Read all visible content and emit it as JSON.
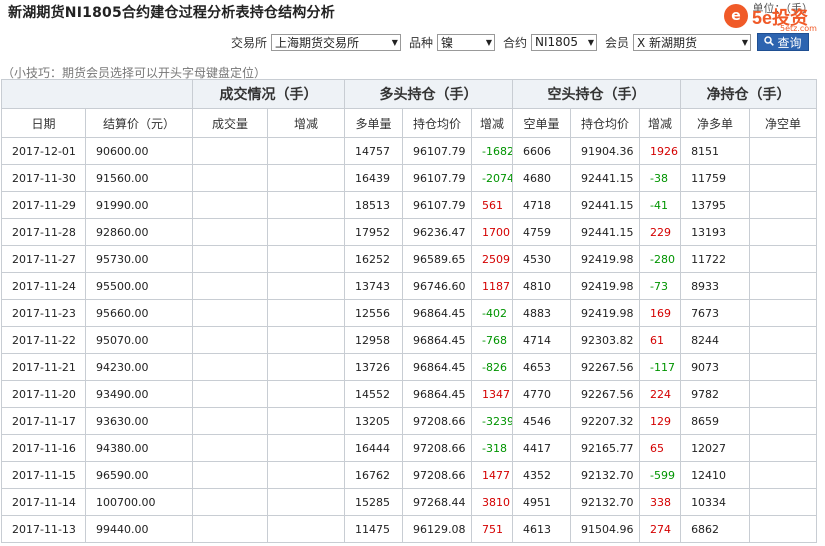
{
  "header": {
    "title": "新湖期货NI1805合约建仓过程分析表持仓结构分析",
    "unit": "单位：（手）"
  },
  "logo": {
    "mark": "e",
    "text": "5e投资",
    "sub": "5etz.com"
  },
  "filters": {
    "exchange_label": "交易所",
    "exchange_value": "上海期货交易所",
    "variety_label": "品种",
    "variety_value": "镍",
    "contract_label": "合约",
    "contract_value": "NI1805",
    "member_label": "会员",
    "member_value": "X 新湖期货",
    "query_label": "查询"
  },
  "tip": "（小技巧：期货会员选择可以开头字母键盘定位）",
  "table": {
    "groups": [
      "成交情况（手）",
      "多头持仓（手）",
      "空头持仓（手）",
      "净持仓（手）"
    ],
    "columns": [
      "日期",
      "结算价（元）",
      "成交量",
      "增减",
      "多单量",
      "持仓均价",
      "增减",
      "空单量",
      "持仓均价",
      "增减",
      "净多单",
      "净空单"
    ],
    "rows": [
      {
        "date": "2017-12-01",
        "settle": "90600.00",
        "vol": "",
        "vol_chg": "",
        "long": "14757",
        "long_avg": "96107.79",
        "long_chg": "-1682",
        "short": "6606",
        "short_avg": "91904.36",
        "short_chg": "1926",
        "net_long": "8151",
        "net_short": ""
      },
      {
        "date": "2017-11-30",
        "settle": "91560.00",
        "vol": "",
        "vol_chg": "",
        "long": "16439",
        "long_avg": "96107.79",
        "long_chg": "-2074",
        "short": "4680",
        "short_avg": "92441.15",
        "short_chg": "-38",
        "net_long": "11759",
        "net_short": ""
      },
      {
        "date": "2017-11-29",
        "settle": "91990.00",
        "vol": "",
        "vol_chg": "",
        "long": "18513",
        "long_avg": "96107.79",
        "long_chg": "561",
        "short": "4718",
        "short_avg": "92441.15",
        "short_chg": "-41",
        "net_long": "13795",
        "net_short": ""
      },
      {
        "date": "2017-11-28",
        "settle": "92860.00",
        "vol": "",
        "vol_chg": "",
        "long": "17952",
        "long_avg": "96236.47",
        "long_chg": "1700",
        "short": "4759",
        "short_avg": "92441.15",
        "short_chg": "229",
        "net_long": "13193",
        "net_short": ""
      },
      {
        "date": "2017-11-27",
        "settle": "95730.00",
        "vol": "",
        "vol_chg": "",
        "long": "16252",
        "long_avg": "96589.65",
        "long_chg": "2509",
        "short": "4530",
        "short_avg": "92419.98",
        "short_chg": "-280",
        "net_long": "11722",
        "net_short": ""
      },
      {
        "date": "2017-11-24",
        "settle": "95500.00",
        "vol": "",
        "vol_chg": "",
        "long": "13743",
        "long_avg": "96746.60",
        "long_chg": "1187",
        "short": "4810",
        "short_avg": "92419.98",
        "short_chg": "-73",
        "net_long": "8933",
        "net_short": ""
      },
      {
        "date": "2017-11-23",
        "settle": "95660.00",
        "vol": "",
        "vol_chg": "",
        "long": "12556",
        "long_avg": "96864.45",
        "long_chg": "-402",
        "short": "4883",
        "short_avg": "92419.98",
        "short_chg": "169",
        "net_long": "7673",
        "net_short": ""
      },
      {
        "date": "2017-11-22",
        "settle": "95070.00",
        "vol": "",
        "vol_chg": "",
        "long": "12958",
        "long_avg": "96864.45",
        "long_chg": "-768",
        "short": "4714",
        "short_avg": "92303.82",
        "short_chg": "61",
        "net_long": "8244",
        "net_short": ""
      },
      {
        "date": "2017-11-21",
        "settle": "94230.00",
        "vol": "",
        "vol_chg": "",
        "long": "13726",
        "long_avg": "96864.45",
        "long_chg": "-826",
        "short": "4653",
        "short_avg": "92267.56",
        "short_chg": "-117",
        "net_long": "9073",
        "net_short": ""
      },
      {
        "date": "2017-11-20",
        "settle": "93490.00",
        "vol": "",
        "vol_chg": "",
        "long": "14552",
        "long_avg": "96864.45",
        "long_chg": "1347",
        "short": "4770",
        "short_avg": "92267.56",
        "short_chg": "224",
        "net_long": "9782",
        "net_short": ""
      },
      {
        "date": "2017-11-17",
        "settle": "93630.00",
        "vol": "",
        "vol_chg": "",
        "long": "13205",
        "long_avg": "97208.66",
        "long_chg": "-3239",
        "short": "4546",
        "short_avg": "92207.32",
        "short_chg": "129",
        "net_long": "8659",
        "net_short": ""
      },
      {
        "date": "2017-11-16",
        "settle": "94380.00",
        "vol": "",
        "vol_chg": "",
        "long": "16444",
        "long_avg": "97208.66",
        "long_chg": "-318",
        "short": "4417",
        "short_avg": "92165.77",
        "short_chg": "65",
        "net_long": "12027",
        "net_short": ""
      },
      {
        "date": "2017-11-15",
        "settle": "96590.00",
        "vol": "",
        "vol_chg": "",
        "long": "16762",
        "long_avg": "97208.66",
        "long_chg": "1477",
        "short": "4352",
        "short_avg": "92132.70",
        "short_chg": "-599",
        "net_long": "12410",
        "net_short": ""
      },
      {
        "date": "2017-11-14",
        "settle": "100700.00",
        "vol": "",
        "vol_chg": "",
        "long": "15285",
        "long_avg": "97268.44",
        "long_chg": "3810",
        "short": "4951",
        "short_avg": "92132.70",
        "short_chg": "338",
        "net_long": "10334",
        "net_short": ""
      },
      {
        "date": "2017-11-13",
        "settle": "99440.00",
        "vol": "",
        "vol_chg": "",
        "long": "11475",
        "long_avg": "96129.08",
        "long_chg": "751",
        "short": "4613",
        "short_avg": "91504.96",
        "short_chg": "274",
        "net_long": "6862",
        "net_short": ""
      }
    ]
  },
  "colors": {
    "increase": "#d40000",
    "decrease": "#009400",
    "header_bg": "#eef2f6",
    "button": "#2d64b0",
    "brand": "#f05a28"
  }
}
